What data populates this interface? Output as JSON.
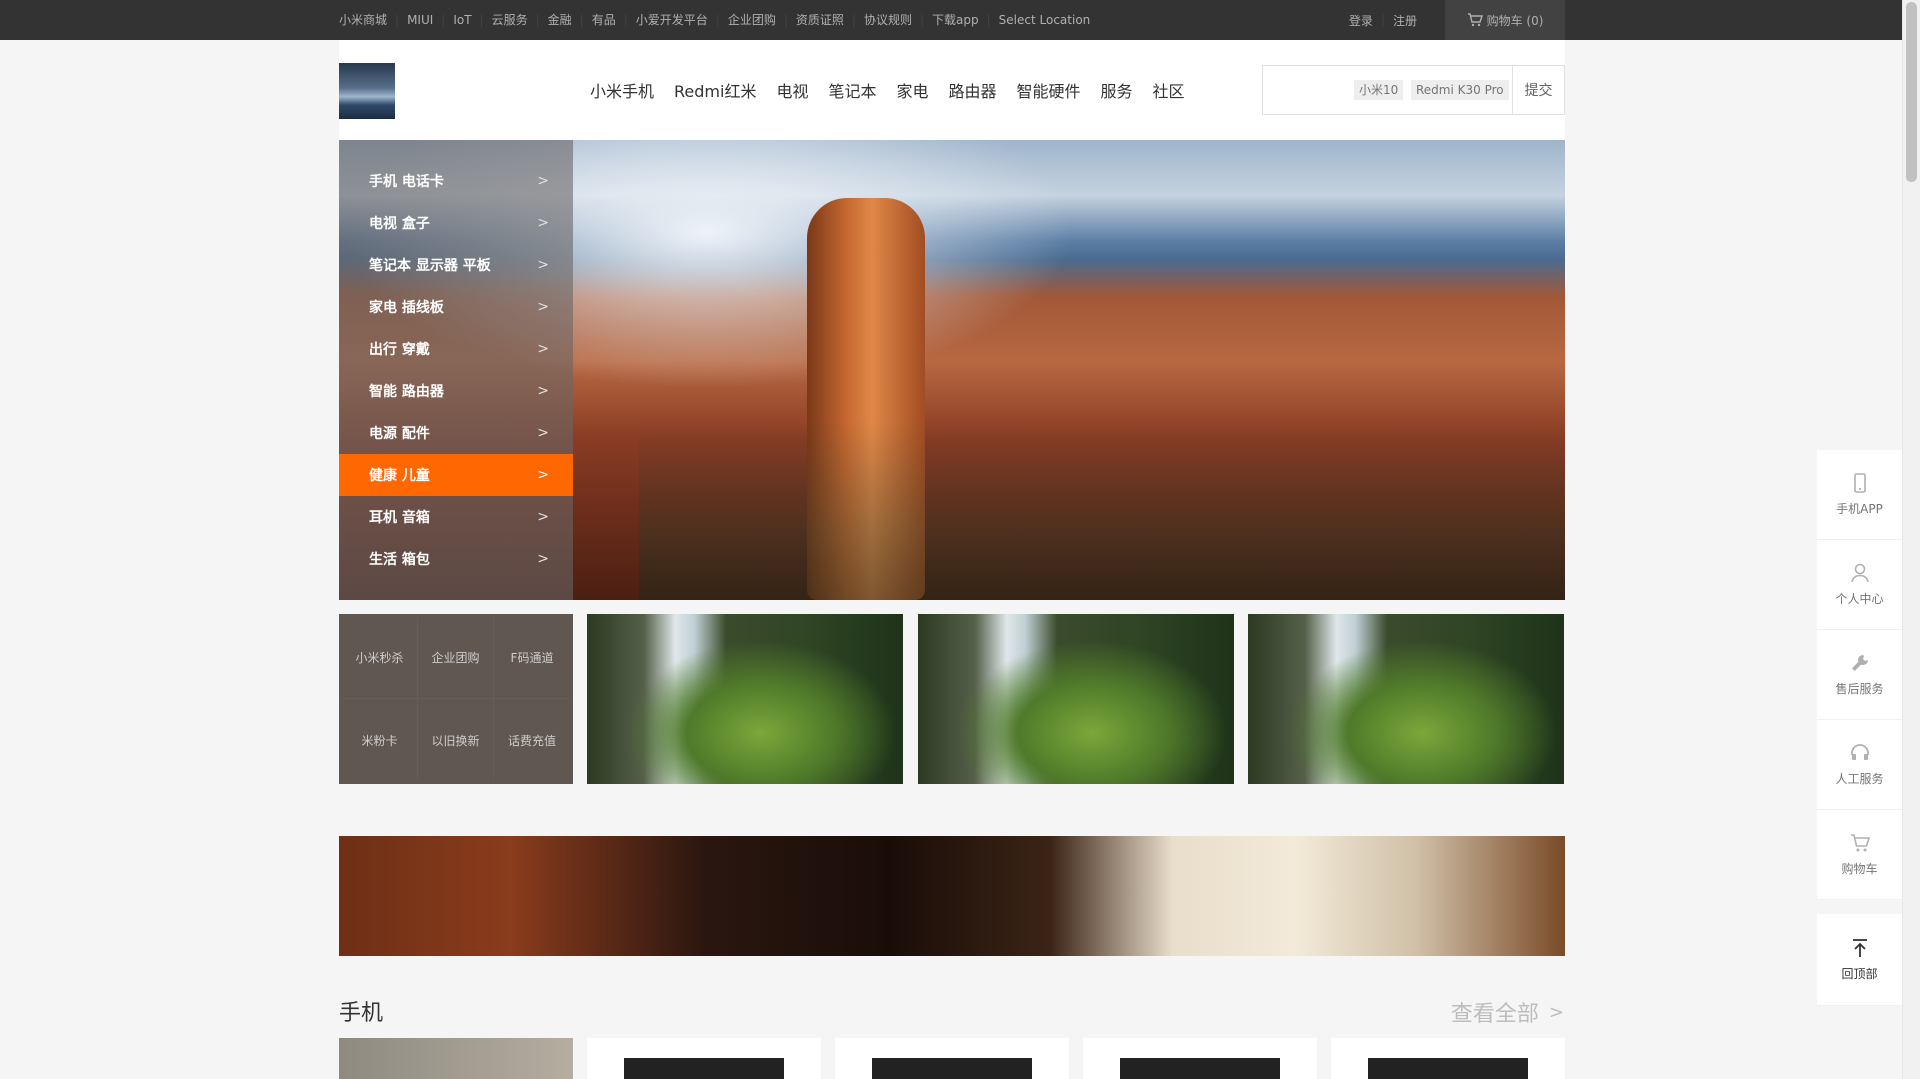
{
  "topbar": {
    "links": [
      "小米商城",
      "MIUI",
      "IoT",
      "云服务",
      "金融",
      "有品",
      "小爱开发平台",
      "企业团购",
      "资质证照",
      "协议规则",
      "下载app",
      "Select Location"
    ],
    "login": "登录",
    "register": "注册",
    "cart": "购物车 (0)"
  },
  "header": {
    "nav": [
      "小米手机",
      "Redmi红米",
      "电视",
      "笔记本",
      "家电",
      "路由器",
      "智能硬件",
      "服务",
      "社区"
    ],
    "search": {
      "placeholder": "",
      "keywords": [
        "小米10",
        "Redmi K30 Pro"
      ],
      "submit": "提交"
    }
  },
  "hero": {
    "categories": [
      {
        "label": "手机 电话卡",
        "active": false
      },
      {
        "label": "电视 盒子",
        "active": false
      },
      {
        "label": "笔记本 显示器 平板",
        "active": false
      },
      {
        "label": "家电 插线板",
        "active": false
      },
      {
        "label": "出行 穿戴",
        "active": false
      },
      {
        "label": "智能 路由器",
        "active": false
      },
      {
        "label": "电源 配件",
        "active": false
      },
      {
        "label": "健康 儿童",
        "active": true
      },
      {
        "label": "耳机 音箱",
        "active": false
      },
      {
        "label": "生活 箱包",
        "active": false
      }
    ]
  },
  "quick_links": [
    "小米秒杀",
    "企业团购",
    "F码通道",
    "米粉卡",
    "以旧换新",
    "话费充值"
  ],
  "section": {
    "title": "手机",
    "more": "查看全部"
  },
  "floatbar": [
    "手机APP",
    "个人中心",
    "售后服务",
    "人工服务",
    "购物车"
  ],
  "back_to_top": "回顶部",
  "colors": {
    "accent": "#ff6700",
    "topbar_bg": "#333333"
  }
}
